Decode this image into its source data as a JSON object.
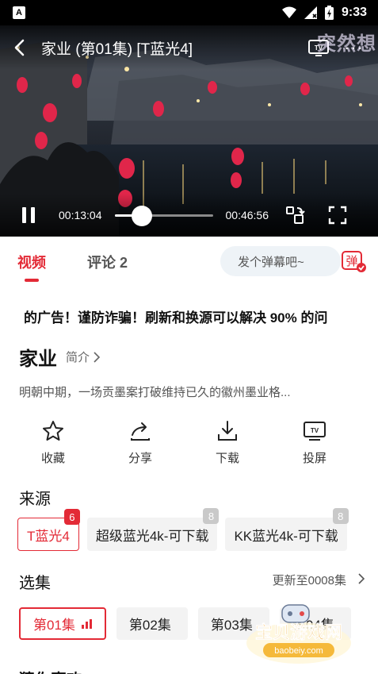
{
  "status_bar": {
    "time": "9:33",
    "app_letter": "A"
  },
  "video": {
    "title": "家业 (第01集) [T蓝光4]",
    "overlay_text": "突然想",
    "current_time": "00:13:04",
    "total_time": "00:46:56",
    "progress": 0.278
  },
  "tabs": [
    {
      "label": "视频"
    },
    {
      "label": "评论 2"
    }
  ],
  "danmaku": {
    "placeholder": "发个弹幕吧~",
    "button_char": "弹"
  },
  "notice": "的广告！谨防诈骗！刷新和换源可以解决 90% 的问",
  "show": {
    "title": "家业",
    "intro_label": "简介",
    "description": "明朝中期，一场贡墨案打破维持已久的徽州墨业格..."
  },
  "actions": [
    {
      "label": "收藏",
      "icon": "star-icon"
    },
    {
      "label": "分享",
      "icon": "share-icon"
    },
    {
      "label": "下载",
      "icon": "download-icon"
    },
    {
      "label": "投屏",
      "icon": "cast-tv-icon"
    }
  ],
  "sources": {
    "title": "来源",
    "items": [
      {
        "label": "T蓝光4",
        "badge": "6"
      },
      {
        "label": "超级蓝光4k-可下载",
        "badge": "8"
      },
      {
        "label": "KK蓝光4k-可下载",
        "badge": "8"
      }
    ]
  },
  "episodes": {
    "title": "选集",
    "update_text": "更新至0008集",
    "items": [
      "第01集",
      "第02集",
      "第03集",
      "第04集"
    ]
  },
  "guess_title": "猜你喜欢",
  "site_logo": {
    "name": "宝贝游戏网",
    "url_text": "baobeiy.com"
  },
  "colors": {
    "accent": "#e32a36",
    "video_bg": "#0b0d10"
  }
}
